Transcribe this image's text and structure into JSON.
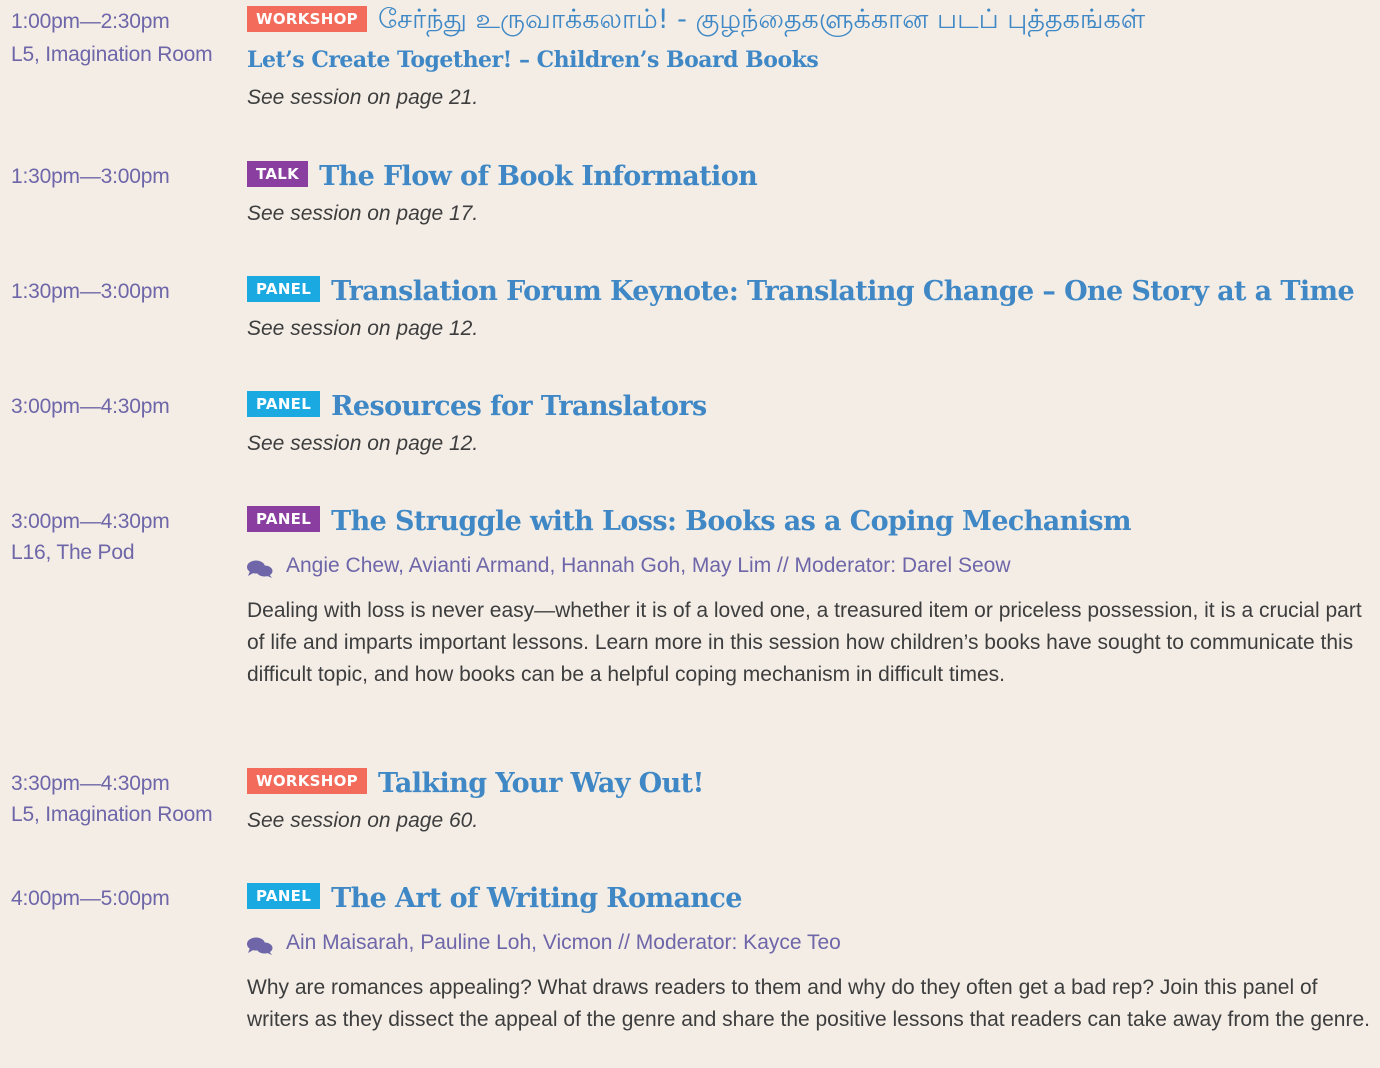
{
  "sessions": [
    {
      "time": "1:00pm—2:30pm",
      "venue": "L5, Imagination Room",
      "badge": "WORKSHOP",
      "title": "சேர்ந்து உருவாக்கலாம்! - குழந்தைகளுக்கான படப் புத்தகங்கள்",
      "subtitle": "Let’s Create Together! – Children’s Board Books",
      "see": "See session on page 21."
    },
    {
      "time": "1:30pm—3:00pm",
      "badge": "TALK",
      "title": "The Flow of Book Information",
      "see": "See session on page 17."
    },
    {
      "time": "1:30pm—3:00pm",
      "badge": "PANEL",
      "title": "Translation Forum Keynote: Translating Change – One Story at a Time",
      "see": "See session on page 12."
    },
    {
      "time": "3:00pm—4:30pm",
      "badge": "PANEL",
      "title": "Resources for Translators",
      "see": "See session on page 12."
    },
    {
      "time": "3:00pm—4:30pm",
      "venue": "L16, The Pod",
      "badge": "PANEL",
      "title": "The Struggle with Loss: Books as a Coping Mechanism",
      "speakers": "Angie Chew, Avianti Armand, Hannah Goh, May Lim // Moderator: Darel Seow",
      "description": "Dealing with loss is never easy—whether it is of a loved one, a treasured item or priceless possession, it is a crucial part of life and imparts important lessons. Learn more in this session how children’s books have sought to communicate this difficult topic, and how books can be a helpful coping mechanism in difficult times."
    },
    {
      "time": "3:30pm—4:30pm",
      "venue": "L5, Imagination Room",
      "badge": "WORKSHOP",
      "title": "Talking Your Way Out!",
      "see": "See session on page 60."
    },
    {
      "time": "4:00pm—5:00pm",
      "badge": "PANEL",
      "title": "The Art of Writing Romance",
      "speakers": "Ain Maisarah, Pauline Loh, Vicmon // Moderator: Kayce Teo",
      "description": "Why are romances appealing? What draws readers to them and why do they often get a bad rep? Join this panel of writers as they dissect the appeal of the genre and share the positive lessons that readers can take away from the genre."
    }
  ],
  "colors": {
    "background": "#f3ede6",
    "title": "#3f88c5",
    "meta": "#6e66a8",
    "workshop": "#f26b5b",
    "talk": "#8a3fa0",
    "panel": "#1ba9e1"
  },
  "icons": {
    "speakers": "chat-bubbles-icon"
  }
}
